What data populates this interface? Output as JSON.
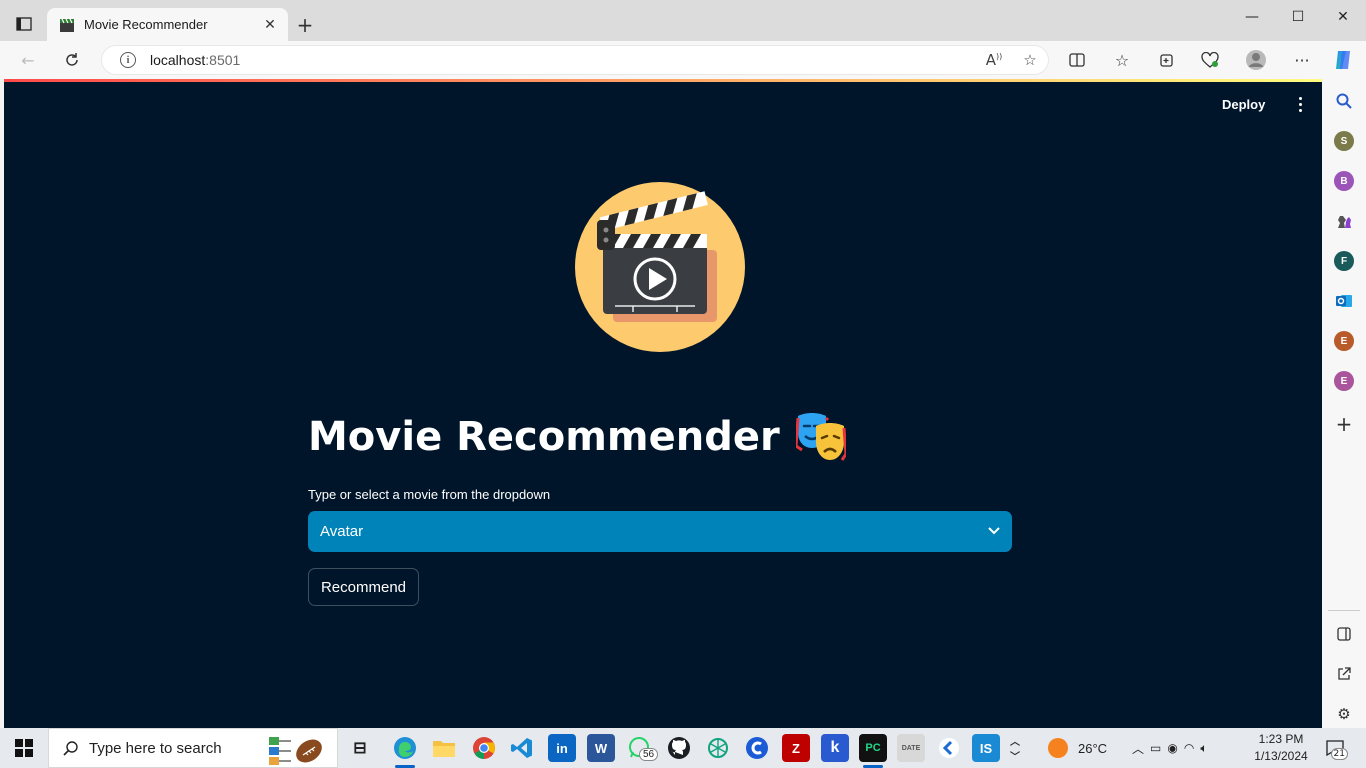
{
  "browser": {
    "tab_title": "Movie Recommender",
    "tab_close": "✕",
    "new_tab": "+",
    "url_host": "localhost",
    "url_port": ":8501",
    "window_controls": {
      "minimize": "—",
      "maximize": "☐",
      "close": "✕"
    }
  },
  "app": {
    "deploy_label": "Deploy",
    "heading": "Movie Recommender",
    "select_label": "Type or select a movie from the dropdown",
    "selected_movie": "Avatar",
    "recommend_label": "Recommend",
    "accent": "#0083b8",
    "background": "#001529"
  },
  "sidebar": {
    "profiles": [
      {
        "letter": "S",
        "color": "#7a7a4a"
      },
      {
        "letter": "B",
        "color": "#9b55b8"
      },
      {
        "letter": "F",
        "color": "#1a5a5a"
      },
      {
        "letter": "E",
        "color": "#b85a2a"
      },
      {
        "letter": "E",
        "color": "#a8559b"
      }
    ]
  },
  "taskbar": {
    "search_placeholder": "Type here to search",
    "whatsapp_badge": "56",
    "temperature": "26°C",
    "time": "1:23 PM",
    "date": "1/13/2024",
    "notifications": "21"
  }
}
